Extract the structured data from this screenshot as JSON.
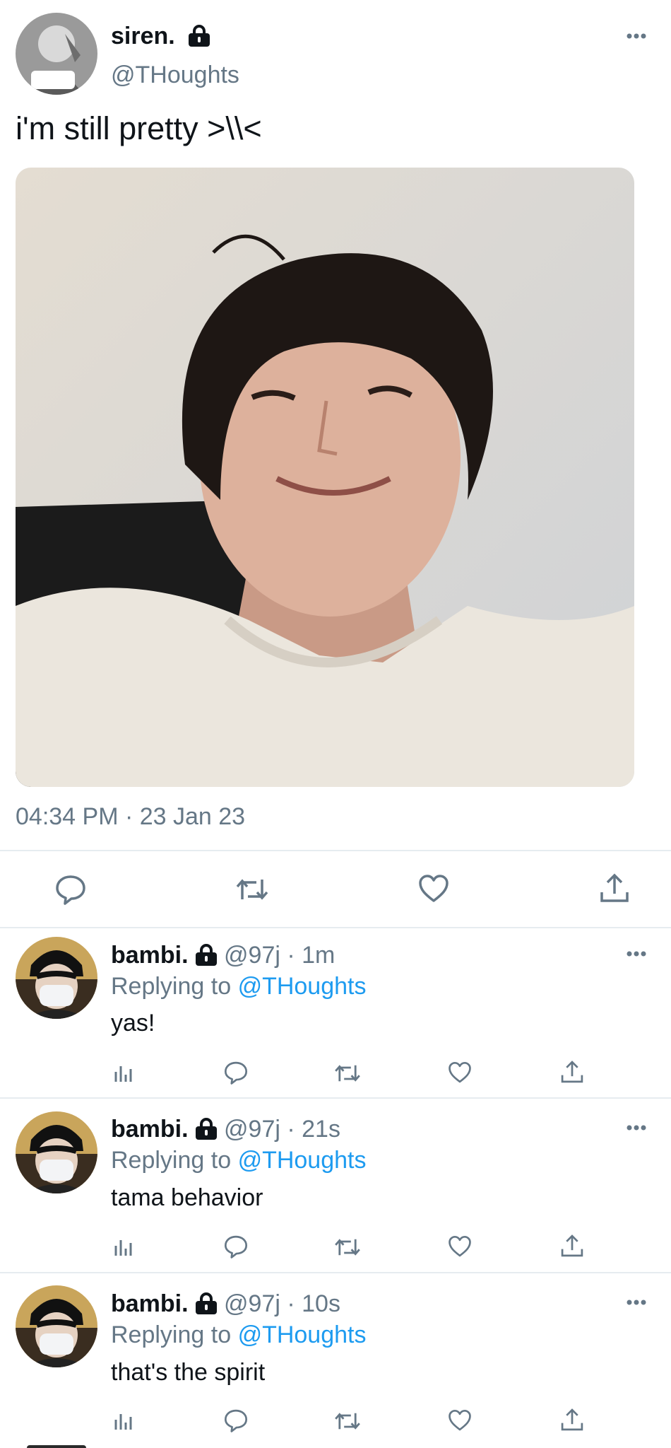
{
  "main_tweet": {
    "display_name": "siren.",
    "handle": "@THoughts",
    "text": "i'm still pretty >\\\\<",
    "timestamp": "04:34 PM · 23 Jan 23"
  },
  "actions": [
    "reply",
    "retweet",
    "like",
    "share"
  ],
  "replies": [
    {
      "display_name": "bambi.",
      "handle_time": "@97j · 1m",
      "replying_prefix": "Replying to",
      "replying_to": "@THoughts",
      "text": "yas!"
    },
    {
      "display_name": "bambi.",
      "handle_time": "@97j · 21s",
      "replying_prefix": "Replying to",
      "replying_to": "@THoughts",
      "text": "tama behavior"
    },
    {
      "display_name": "bambi.",
      "handle_time": "@97j · 10s",
      "replying_prefix": "Replying to",
      "replying_to": "@THoughts",
      "text": "that's the spirit"
    }
  ],
  "colors": {
    "link": "#1d9bf0",
    "muted": "#657786",
    "divider": "#e6ecf0"
  }
}
